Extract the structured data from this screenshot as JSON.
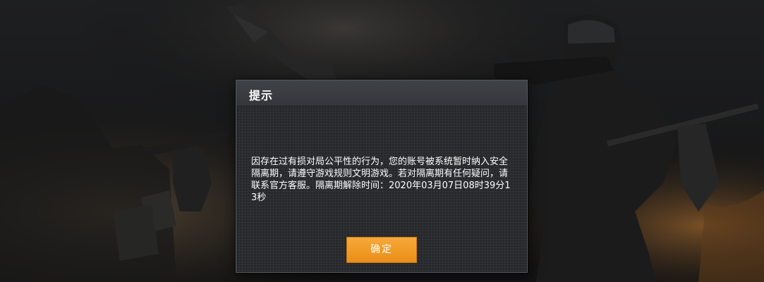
{
  "dialog": {
    "title": "提示",
    "message": "因存在过有损对局公平性的行为，您的账号被系统暂时纳入安全隔离期，请遵守游戏规则文明游戏。若对隔离期有任何疑问，请联系官方客服。隔离期解除时间：2020年03月07日08时39分13秒",
    "confirm_label": "确定"
  },
  "colors": {
    "dialog_bg": "#2b2d31",
    "header_bg": "#3a3d42",
    "accent_button": "#f09a26",
    "text": "#ffffff"
  },
  "background": {
    "description_icon": "battle-scene-background"
  }
}
